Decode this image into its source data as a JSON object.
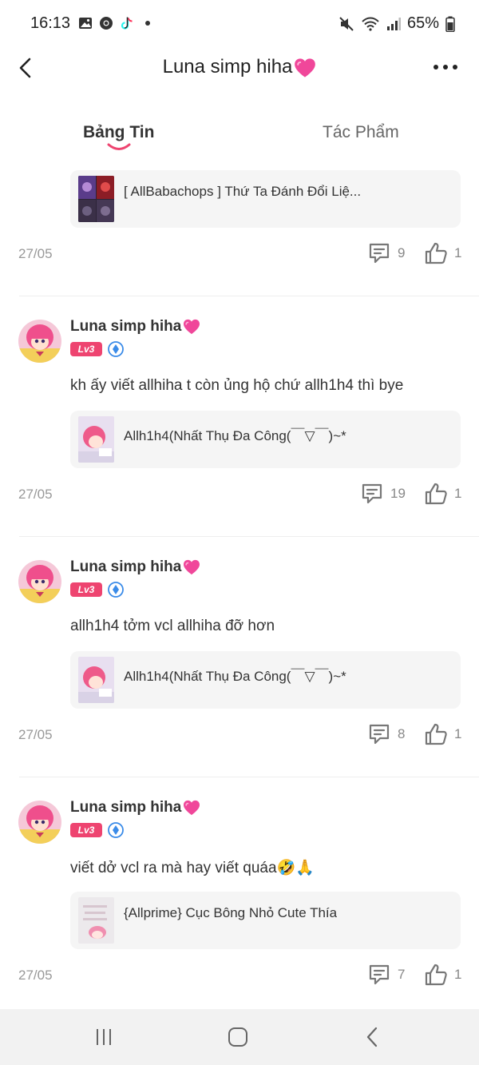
{
  "status": {
    "time": "16:13",
    "battery": "65%",
    "icons": [
      "gallery-icon",
      "chrome-icon",
      "tiktok-icon",
      "mute-icon",
      "wifi-icon",
      "signal-icon",
      "battery-icon"
    ]
  },
  "header": {
    "title": "Luna simp hiha"
  },
  "tabs": [
    {
      "label": "Bảng Tin",
      "active": true
    },
    {
      "label": "Tác Phẩm",
      "active": false
    }
  ],
  "posts": [
    {
      "work_title": "[ AllBabachops ] Thứ Ta Đánh Đổi Liệ...",
      "date": "27/05",
      "comments": "9",
      "likes": "1"
    },
    {
      "author": "Luna simp hiha",
      "level": "Lv3",
      "text": "kh ấy viết allhiha t còn ủng hộ chứ allh1h4 thì bye",
      "work_title": "Allh1h4(Nhất Thụ Đa Công(￣▽￣)~*",
      "date": "27/05",
      "comments": "19",
      "likes": "1"
    },
    {
      "author": "Luna simp hiha",
      "level": "Lv3",
      "text": "allh1h4 tởm vcl allhiha đỡ hơn",
      "work_title": "Allh1h4(Nhất Thụ Đa Công(￣▽￣)~*",
      "date": "27/05",
      "comments": "8",
      "likes": "1"
    },
    {
      "author": "Luna simp hiha",
      "level": "Lv3",
      "text": "viết dở vcl ra mà hay viết quáa🤣🙏",
      "work_title": "{Allprime} Cục Bông Nhỏ Cute Thía",
      "date": "27/05",
      "comments": "7",
      "likes": "1"
    }
  ],
  "colors": {
    "accent": "#ee4470",
    "background": "#ffffff",
    "card": "#f5f5f5",
    "muted": "#999999"
  }
}
